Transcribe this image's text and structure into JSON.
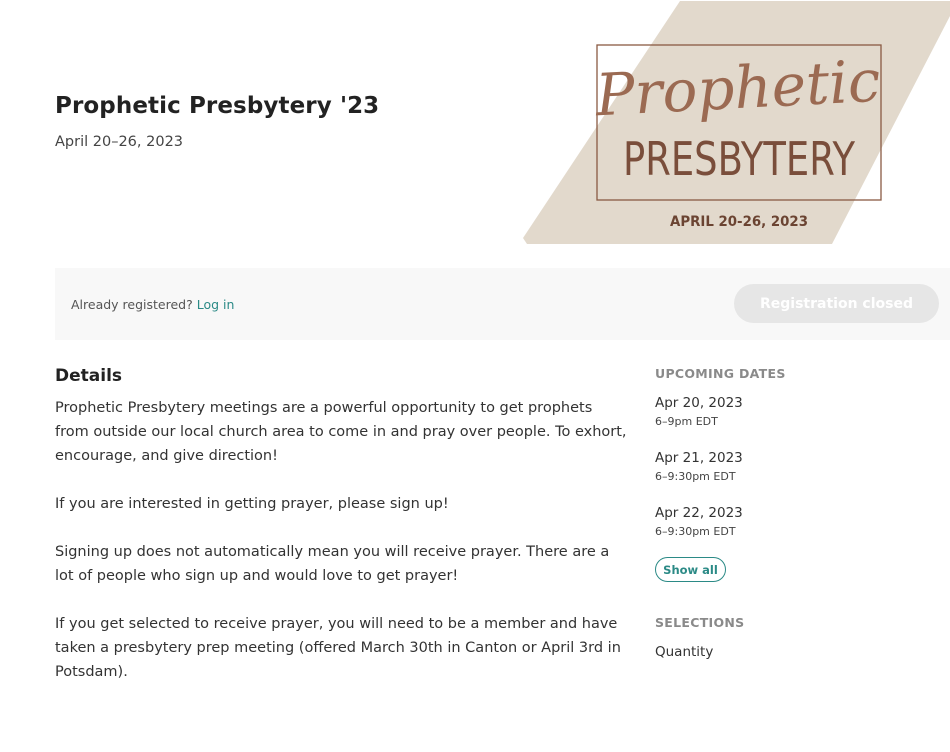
{
  "event": {
    "title": "Prophetic Presbytery '23",
    "dates": "April 20–26, 2023"
  },
  "banner": {
    "script_word": "Prophetic",
    "block_word": "PRESBYTERY",
    "date_text": "APRIL 20-26, 2023",
    "colors": {
      "backdrop": "#e2d9cc",
      "frame": "#8a5a43",
      "script": "#9b6a52",
      "block": "#7a4e3b",
      "date": "#6b4432"
    }
  },
  "registration": {
    "already_text": "Already registered?",
    "login_label": "Log in",
    "button_label": "Registration closed"
  },
  "details": {
    "heading": "Details",
    "paragraphs": [
      "Prophetic Presbytery meetings are a powerful opportunity to get prophets from outside our local church area to come in and pray over people. To exhort, encourage, and give direction!",
      "If you are interested in getting prayer, please sign up!",
      "Signing up does not automatically mean you will receive prayer. There are a lot of people who sign up and would love to get prayer!",
      "If you get selected to receive prayer, you will need to be a member and have taken a presbytery prep meeting (offered March 30th in Canton or April 3rd in Potsdam)."
    ]
  },
  "sidebar": {
    "upcoming_heading": "UPCOMING DATES",
    "dates": [
      {
        "day": "Apr 20, 2023",
        "time": "6–9pm EDT"
      },
      {
        "day": "Apr 21, 2023",
        "time": "6–9:30pm EDT"
      },
      {
        "day": "Apr 22, 2023",
        "time": "6–9:30pm EDT"
      }
    ],
    "show_all_label": "Show all",
    "selections_heading": "SELECTIONS",
    "quantity_label": "Quantity"
  },
  "colors": {
    "accent": "#2b8a86",
    "button_disabled": "#e6e6e6",
    "panel_bg": "#f8f8f8"
  }
}
